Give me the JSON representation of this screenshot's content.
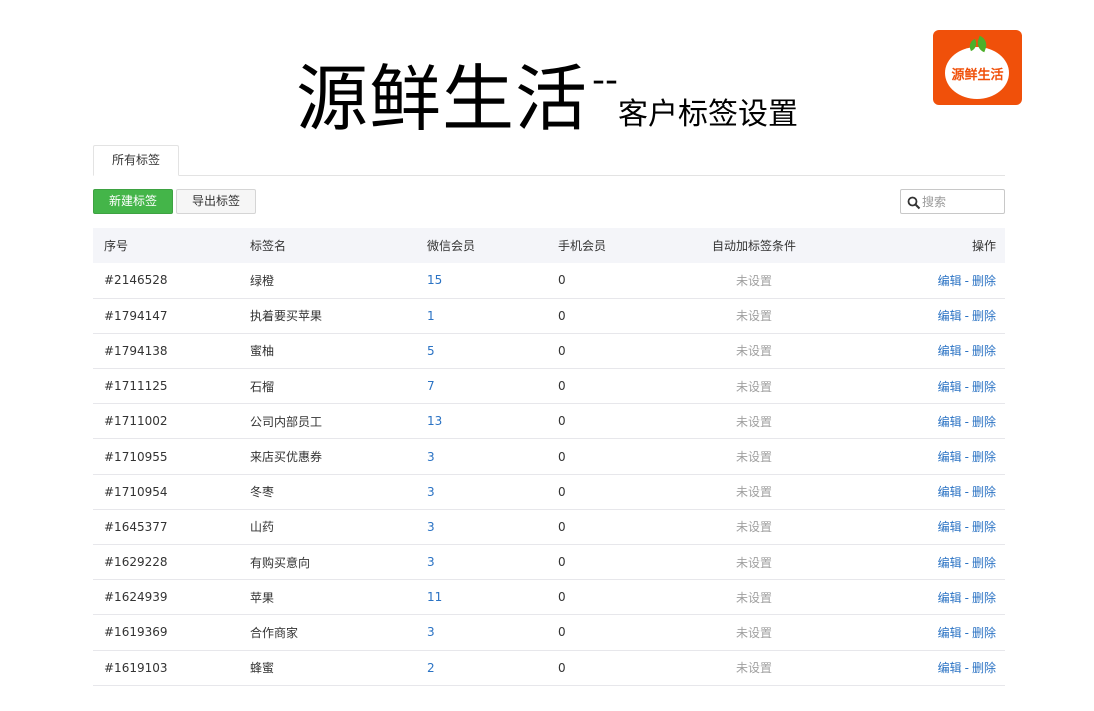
{
  "header": {
    "title_main": "源鲜生活",
    "title_sep": "--",
    "title_sub": "客户标签设置"
  },
  "logo": {
    "text": "源鲜生活",
    "icon": "orange-logo-icon",
    "color": "#f0500a"
  },
  "tabs": [
    {
      "label": "所有标签",
      "active": true
    }
  ],
  "toolbar": {
    "new_label": "新建标签",
    "export_label": "导出标签",
    "search_placeholder": "搜索",
    "search_icon": "search-icon"
  },
  "table": {
    "columns": [
      "序号",
      "标签名",
      "微信会员",
      "手机会员",
      "自动加标签条件",
      "操作"
    ],
    "rows": [
      {
        "id": "#2146528",
        "name": "绿橙",
        "wechat": "15",
        "mobile": "0",
        "condition": "未设置",
        "edit": "编辑",
        "sep": "-",
        "delete": "删除"
      },
      {
        "id": "#1794147",
        "name": "执着要买苹果",
        "wechat": "1",
        "mobile": "0",
        "condition": "未设置",
        "edit": "编辑",
        "sep": "-",
        "delete": "删除"
      },
      {
        "id": "#1794138",
        "name": "蜜柚",
        "wechat": "5",
        "mobile": "0",
        "condition": "未设置",
        "edit": "编辑",
        "sep": "-",
        "delete": "删除"
      },
      {
        "id": "#1711125",
        "name": "石榴",
        "wechat": "7",
        "mobile": "0",
        "condition": "未设置",
        "edit": "编辑",
        "sep": "-",
        "delete": "删除"
      },
      {
        "id": "#1711002",
        "name": "公司内部员工",
        "wechat": "13",
        "mobile": "0",
        "condition": "未设置",
        "edit": "编辑",
        "sep": "-",
        "delete": "删除"
      },
      {
        "id": "#1710955",
        "name": "来店买优惠券",
        "wechat": "3",
        "mobile": "0",
        "condition": "未设置",
        "edit": "编辑",
        "sep": "-",
        "delete": "删除"
      },
      {
        "id": "#1710954",
        "name": "冬枣",
        "wechat": "3",
        "mobile": "0",
        "condition": "未设置",
        "edit": "编辑",
        "sep": "-",
        "delete": "删除"
      },
      {
        "id": "#1645377",
        "name": "山药",
        "wechat": "3",
        "mobile": "0",
        "condition": "未设置",
        "edit": "编辑",
        "sep": "-",
        "delete": "删除"
      },
      {
        "id": "#1629228",
        "name": "有购买意向",
        "wechat": "3",
        "mobile": "0",
        "condition": "未设置",
        "edit": "编辑",
        "sep": "-",
        "delete": "删除"
      },
      {
        "id": "#1624939",
        "name": "苹果",
        "wechat": "11",
        "mobile": "0",
        "condition": "未设置",
        "edit": "编辑",
        "sep": "-",
        "delete": "删除"
      },
      {
        "id": "#1619369",
        "name": "合作商家",
        "wechat": "3",
        "mobile": "0",
        "condition": "未设置",
        "edit": "编辑",
        "sep": "-",
        "delete": "删除"
      },
      {
        "id": "#1619103",
        "name": "蜂蜜",
        "wechat": "2",
        "mobile": "0",
        "condition": "未设置",
        "edit": "编辑",
        "sep": "-",
        "delete": "删除"
      }
    ]
  },
  "colors": {
    "primary_green": "#44b549",
    "link_blue": "#2b73c4",
    "muted_gray": "#a0a0a0",
    "header_bg": "#f4f5f9"
  }
}
